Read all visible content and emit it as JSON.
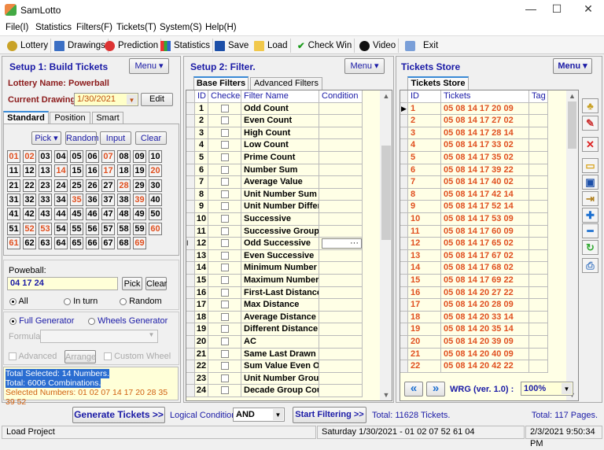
{
  "window": {
    "title": "SamLotto",
    "min": "—",
    "max": "☐",
    "close": "✕"
  },
  "menu": [
    "File(I)",
    "Statistics",
    "Filters(F)",
    "Tickets(T)",
    "System(S)",
    "Help(H)"
  ],
  "toolbar": [
    "Lottery",
    "Drawings",
    "Prediction",
    "Statistics",
    "Save",
    "Load",
    "Check Win",
    "Video",
    "Exit"
  ],
  "setup1": {
    "title": "Setup 1: Build  Tickets",
    "menu": "Menu ▾",
    "lottery_label": "Lottery  Name: Powerball",
    "drawing_label": "Current Drawing:",
    "drawing_value": "1/30/2021",
    "edit": "Edit",
    "tabs": [
      "Standard",
      "Position",
      "Smart"
    ],
    "pick": "Pick ▾",
    "random": "Random",
    "input": "Input",
    "clear": "Clear",
    "numbers": [
      "01",
      "02",
      "03",
      "04",
      "05",
      "06",
      "07",
      "08",
      "09",
      "10",
      "11",
      "12",
      "13",
      "14",
      "15",
      "16",
      "17",
      "18",
      "19",
      "20",
      "21",
      "22",
      "23",
      "24",
      "25",
      "26",
      "27",
      "28",
      "29",
      "30",
      "31",
      "32",
      "33",
      "34",
      "35",
      "36",
      "37",
      "38",
      "39",
      "40",
      "41",
      "42",
      "43",
      "44",
      "45",
      "46",
      "47",
      "48",
      "49",
      "50",
      "51",
      "52",
      "53",
      "54",
      "55",
      "56",
      "57",
      "58",
      "59",
      "60",
      "61",
      "62",
      "63",
      "64",
      "65",
      "66",
      "67",
      "68",
      "69"
    ],
    "selected": [
      "01",
      "02",
      "07",
      "14",
      "17",
      "20",
      "28",
      "35",
      "39",
      "52",
      "53",
      "60",
      "61",
      "69"
    ],
    "powerball_label": "Poweball:",
    "powerball_value": "04 17 24",
    "pb_pick": "Pick",
    "pb_clear": "Clear",
    "mode_all": "All",
    "mode_inturn": "In turn",
    "mode_random": "Random",
    "full_gen": "Full Generator",
    "wheels_gen": "Wheels Generator",
    "formula": "Formula:",
    "advanced": "Advanced",
    "arrange": "Arrange",
    "custom_wheel": "Custom Wheel",
    "summary1": "Total Selected: 14 Numbers.",
    "summary2": "Total: 6006 Combinations.",
    "summary3": "Selected Numbers: 01 02 07 14 17 20 28 35 39 52",
    "generate": "Generate Tickets >>"
  },
  "setup2": {
    "title": "Setup 2: Filter.",
    "menu": "Menu ▾",
    "tabs": [
      "Base Filters",
      "Advanced Filters"
    ],
    "columns": [
      "ID",
      "Checked",
      "Filter Name",
      "Condition"
    ],
    "filters": [
      "Odd Count",
      "Even Count",
      "High Count",
      "Low Count",
      "Prime Count",
      "Number Sum",
      "Average Value",
      "Unit Number Sum",
      "Unit Number Differe",
      "Successive",
      "Successive Groups",
      "Odd Successive",
      "Even Successive",
      "Minimum Number",
      "Maximum Number",
      "First-Last Distance",
      "Max Distance",
      "Average Distance",
      "Different Distance",
      "AC",
      "Same Last Drawn",
      "Sum Value Even Od",
      "Unit Number Group",
      "Decade Group Cour"
    ],
    "logical_label": "Logical Condition:",
    "logical_value": "AND",
    "start": "Start Filtering >>",
    "total_tickets": "Total: 11628 Tickets."
  },
  "store": {
    "title": "Tickets Store",
    "menu": "Menu ▾",
    "tab": "Tickets Store",
    "columns": [
      "ID",
      "Tickets",
      "Tag"
    ],
    "tickets": [
      "05 08 14 17 20 09",
      "05 08 14 17 27 02",
      "05 08 14 17 28 14",
      "05 08 14 17 33 02",
      "05 08 14 17 35 02",
      "05 08 14 17 39 22",
      "05 08 14 17 40 02",
      "05 08 14 17 42 14",
      "05 08 14 17 52 14",
      "05 08 14 17 53 09",
      "05 08 14 17 60 09",
      "05 08 14 17 65 02",
      "05 08 14 17 67 02",
      "05 08 14 17 68 02",
      "05 08 14 17 69 22",
      "05 08 14 20 27 22",
      "05 08 14 20 28 09",
      "05 08 14 20 33 14",
      "05 08 14 20 35 14",
      "05 08 14 20 39 09",
      "05 08 14 20 40 09",
      "05 08 14 20 42 22"
    ],
    "prev": "«",
    "next": "»",
    "wrg": "WRG (ver. 1.0) :",
    "zoom": "100%",
    "total_pages": "Total: 117 Pages."
  },
  "status": {
    "left": "Load Project",
    "middle": "Saturday 1/30/2021 - 01 02 07 52 61 04",
    "right": "2/3/2021 9:50:34 PM"
  },
  "colors": {
    "accent": "#1a1aa6",
    "selected": "#e05020",
    "grid_bg": "#ffffe6",
    "dark_red": "#8b1a1a"
  }
}
